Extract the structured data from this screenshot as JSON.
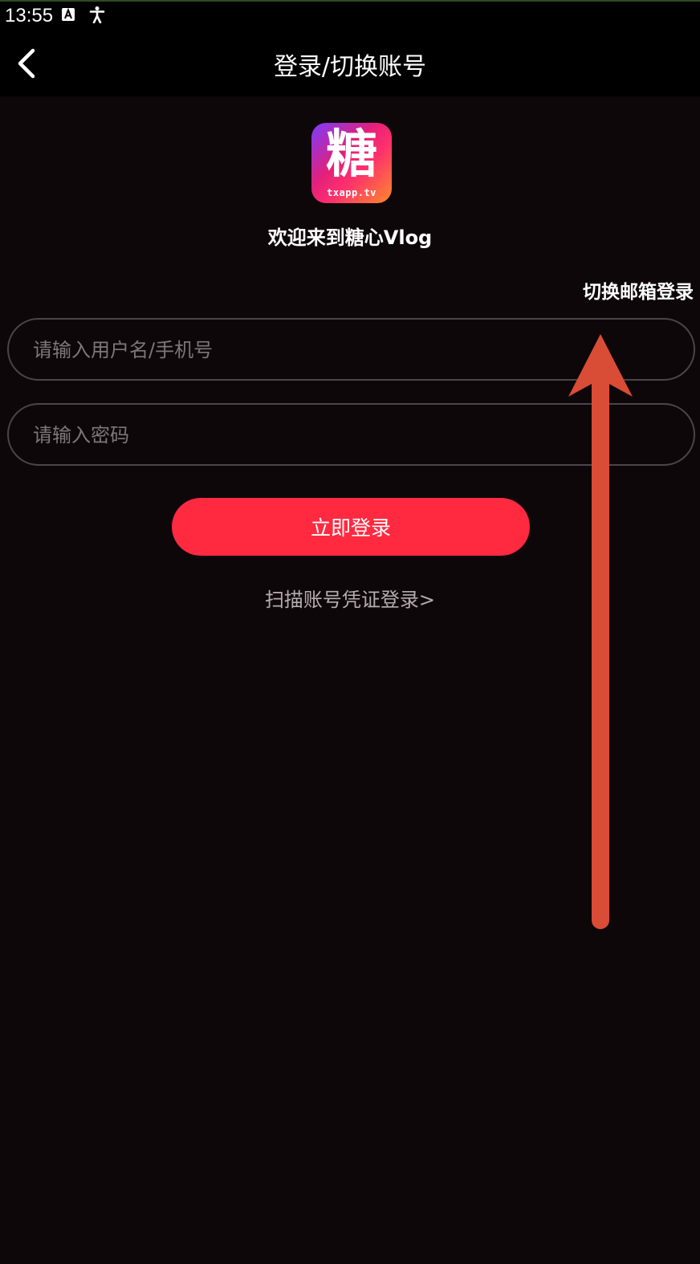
{
  "status_bar": {
    "time": "13:55",
    "icons": [
      "text-a-icon",
      "accessibility-icon"
    ]
  },
  "header": {
    "title": "登录/切换账号",
    "back_icon": "chevron-left-icon"
  },
  "logo": {
    "glyph": "糖",
    "caption": "txapp.tv"
  },
  "welcome": "欢迎来到糖心Vlog",
  "switch_email_label": "切换邮箱登录",
  "form": {
    "username_placeholder": "请输入用户名/手机号",
    "username_value": "",
    "password_placeholder": "请输入密码",
    "password_value": ""
  },
  "login_button_label": "立即登录",
  "scan_link_label": "扫描账号凭证登录>",
  "colors": {
    "background": "#0e070a",
    "bar": "#000000",
    "accent": "#ff2a40",
    "annotation_arrow": "#d94c35"
  }
}
